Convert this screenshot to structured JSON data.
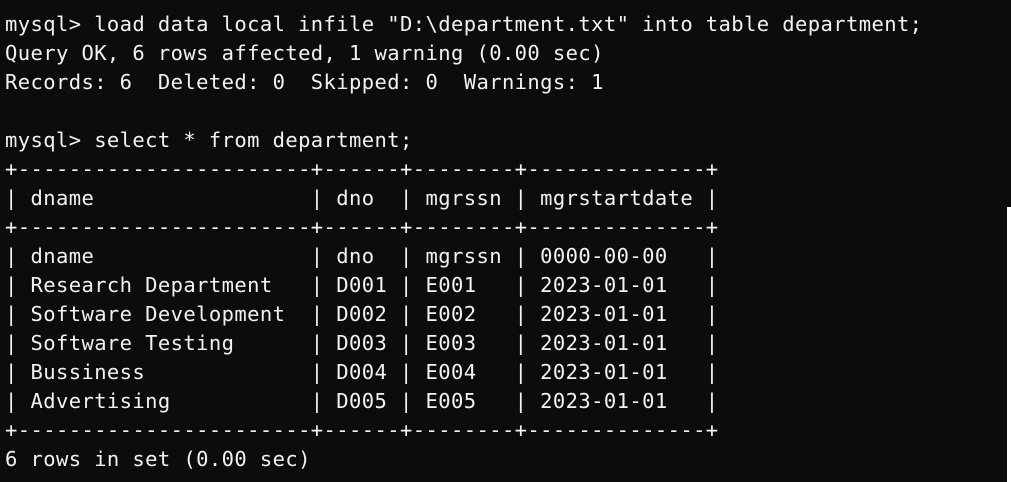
{
  "terminal": {
    "command_load": "mysql> load data local infile \"D:\\department.txt\" into table department;",
    "query_ok": "Query OK, 6 rows affected, 1 warning (0.00 sec)",
    "records": "Records: 6  Deleted: 0  Skipped: 0  Warnings: 1",
    "blank": "",
    "command_select": "mysql> select * from department;",
    "border_top": "+-----------------------+------+--------+--------------+",
    "header_row": "| dname                 | dno  | mgrssn | mgrstartdate |",
    "border_mid": "+-----------------------+------+--------+--------------+",
    "rows": [
      "| dname                 | dno  | mgrssn | 0000-00-00   |",
      "| Research Department   | D001 | E001   | 2023-01-01   |",
      "| Software Development  | D002 | E002   | 2023-01-01   |",
      "| Software Testing      | D003 | E003   | 2023-01-01   |",
      "| Bussiness             | D004 | E004   | 2023-01-01   |",
      "| Advertising           | D005 | E005   | 2023-01-01   |"
    ],
    "border_bottom": "+-----------------------+------+--------+--------------+",
    "result_summary": "6 rows in set (0.00 sec)"
  },
  "colors": {
    "background": "#0c0c0c",
    "foreground": "#f2f2f2"
  }
}
